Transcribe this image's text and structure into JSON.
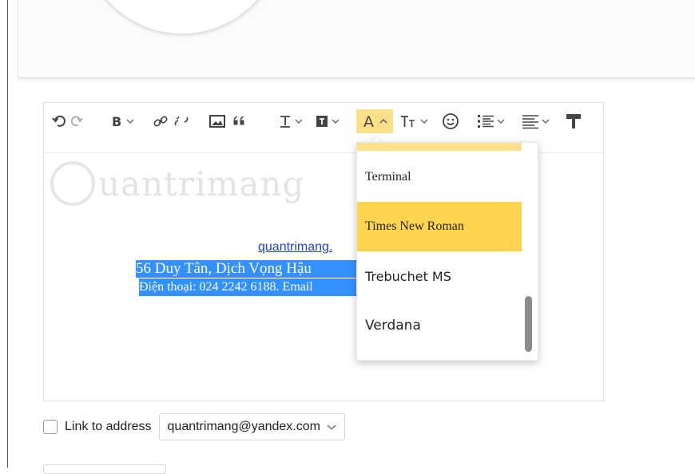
{
  "editor": {
    "watermark": "uantrimang",
    "link_text": "quantrimang.",
    "selected_line1": "56 Duy Tân, Dịch Vọng Hậu",
    "selected_line2": "Điện thoại: 024 2242 6188. Email"
  },
  "font_dropdown": {
    "items": [
      {
        "label": "Terminal",
        "font": "\"Liberation Serif\", serif",
        "highlighted": false
      },
      {
        "label": "Times New Roman",
        "font": "\"Liberation Serif\", serif",
        "highlighted": true
      },
      {
        "label": "Trebuchet MS",
        "font": "\"DejaVu Sans\", sans-serif",
        "highlighted": false
      },
      {
        "label": "Verdana",
        "font": "\"DejaVu Sans\", sans-serif",
        "highlighted": false
      }
    ]
  },
  "footer": {
    "link_to_address_label": "Link to address",
    "address_value": "quantrimang@yandex.com"
  },
  "colors": {
    "accent_yellow": "#ffd54f",
    "selection_blue": "#3390ff",
    "link_blue": "#1f3fd6"
  }
}
